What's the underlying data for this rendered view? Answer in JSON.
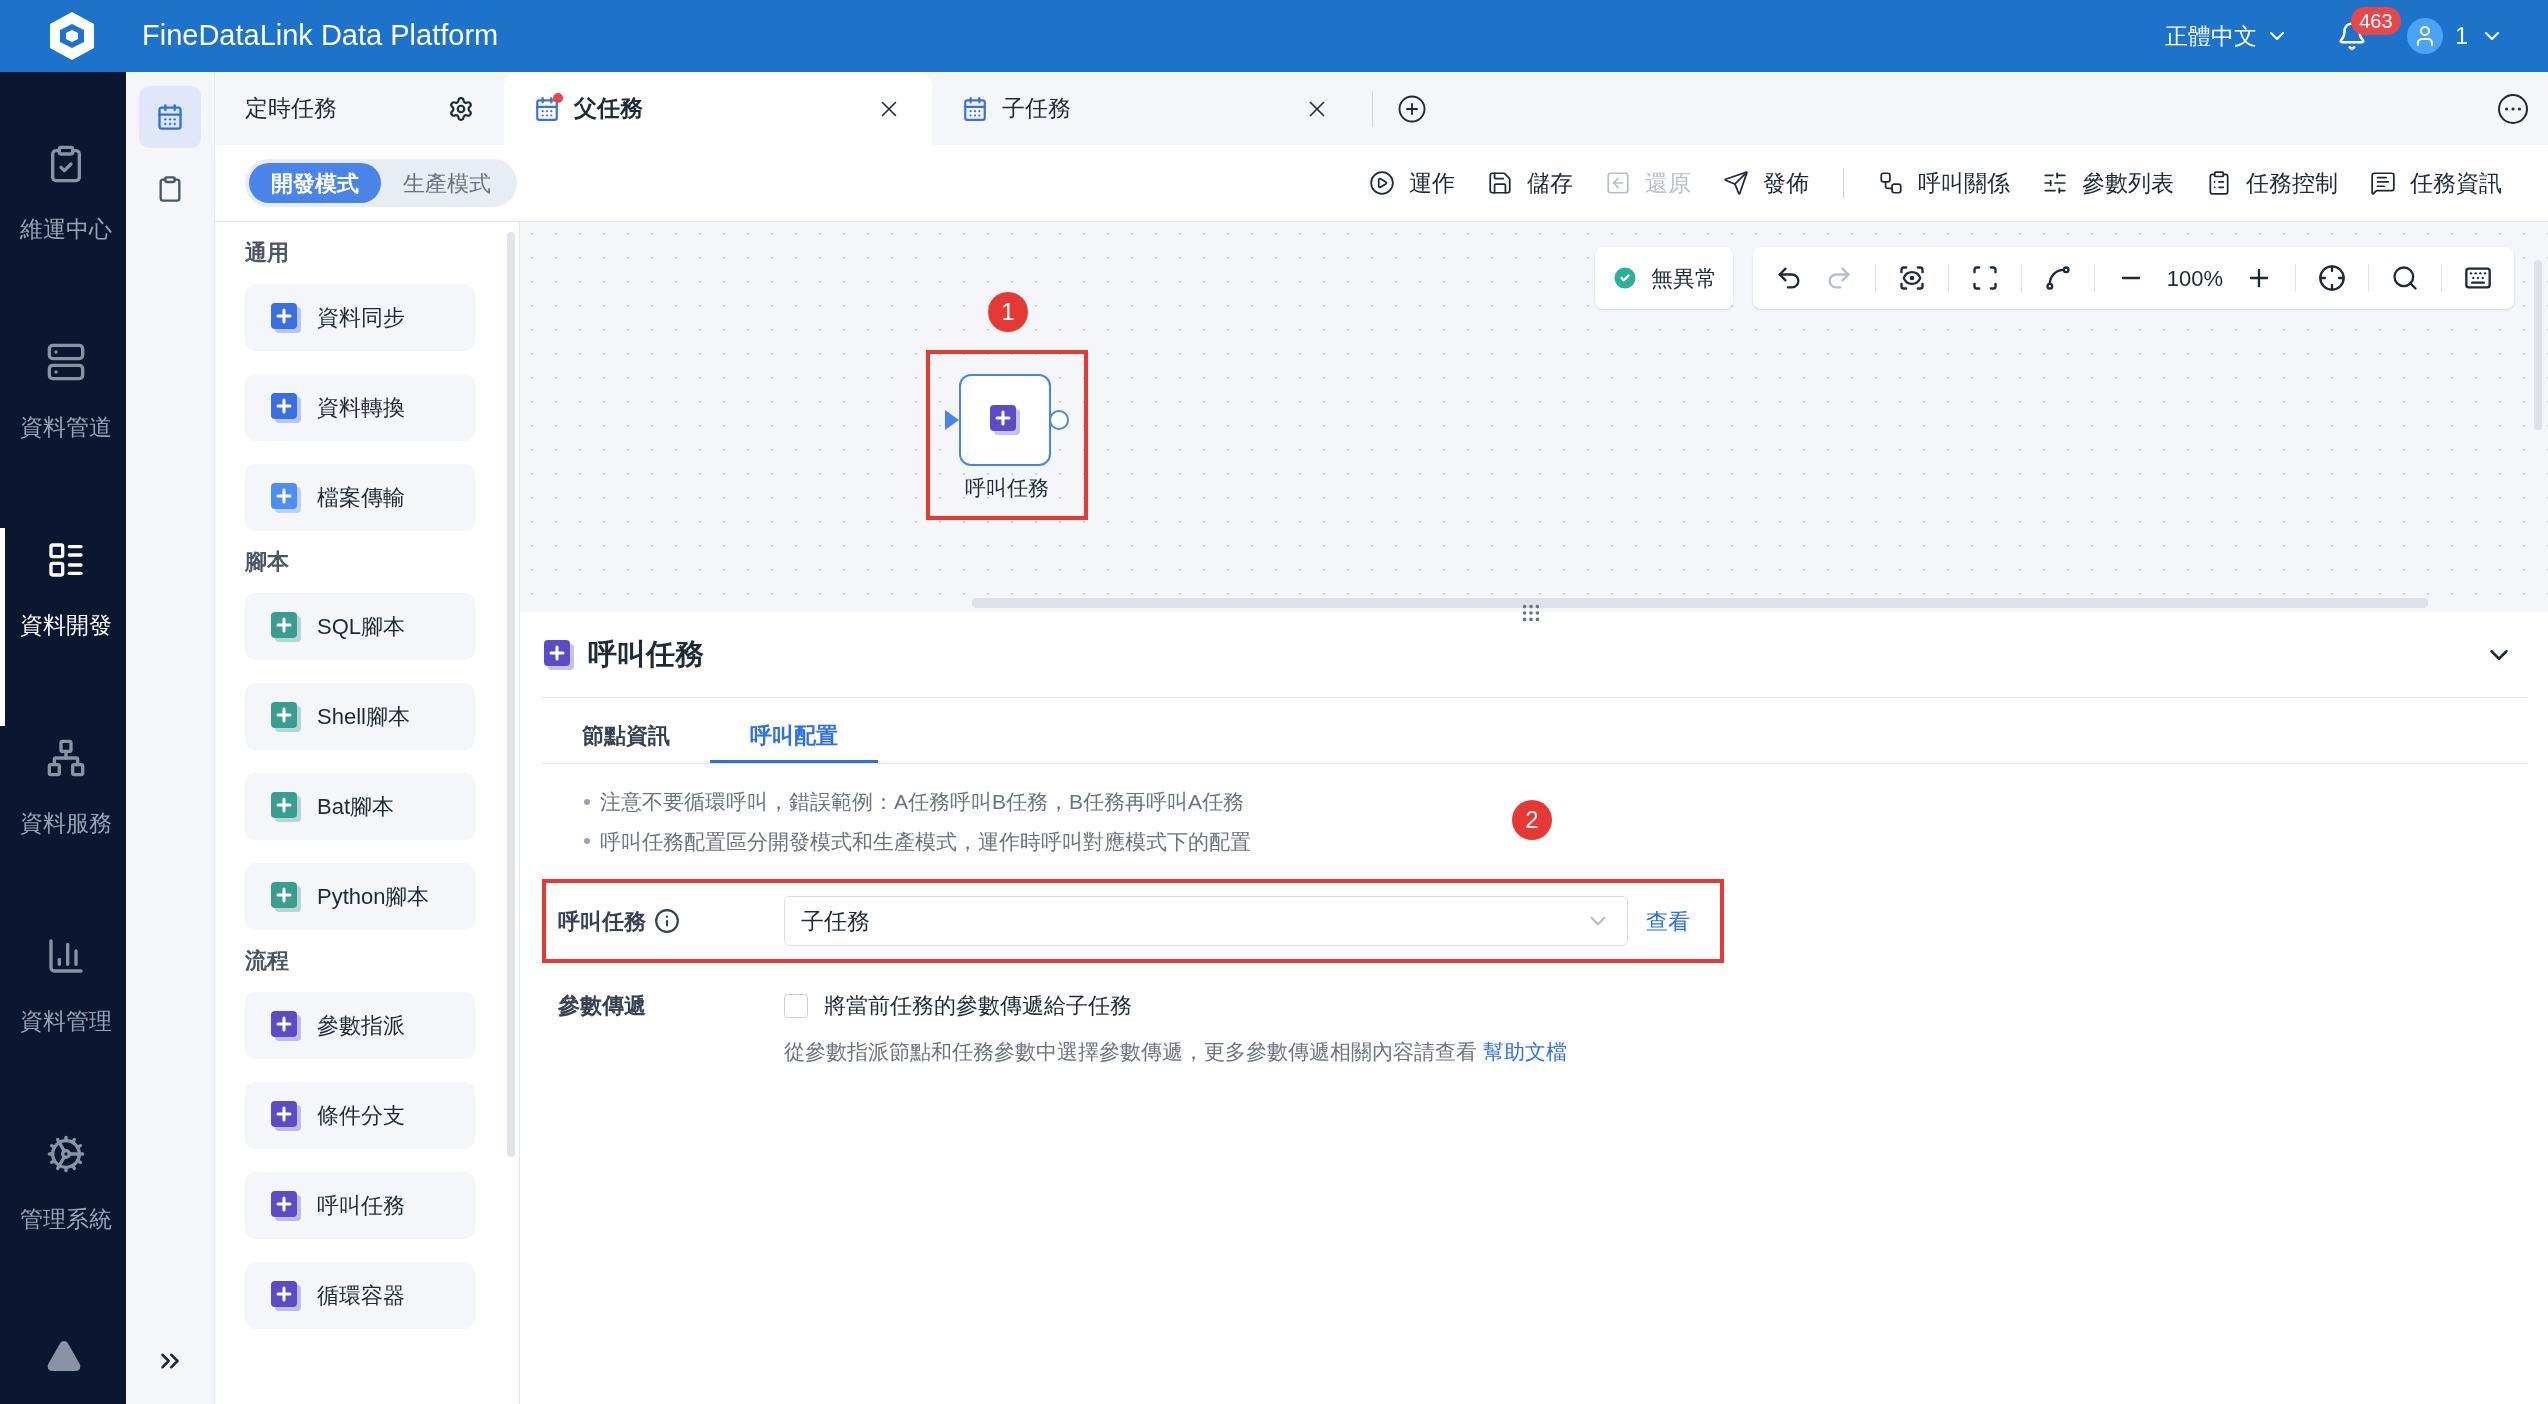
{
  "header": {
    "title": "FineDataLink Data Platform",
    "language": "正體中文",
    "notifications": "463",
    "user": "1"
  },
  "nav": {
    "items": [
      {
        "kind": "ops",
        "label": "維運中心",
        "selected": false
      },
      {
        "kind": "pipeline",
        "label": "資料管道",
        "selected": false
      },
      {
        "kind": "dev",
        "label": "資料開發",
        "selected": true
      },
      {
        "kind": "service",
        "label": "資料服務",
        "selected": false
      },
      {
        "kind": "manage",
        "label": "資料管理",
        "selected": false
      },
      {
        "kind": "system",
        "label": "管理系統",
        "selected": false
      }
    ]
  },
  "subnav": {
    "items": [
      {
        "kind": "task",
        "selected": true
      },
      {
        "kind": "clipboard",
        "selected": false
      }
    ]
  },
  "tabs": [
    {
      "kind": "scheduled",
      "label": "定時任務",
      "selected": false
    },
    {
      "kind": "task",
      "label": "父任務",
      "selected": true,
      "modified": true
    },
    {
      "kind": "task",
      "label": "子任務",
      "selected": false,
      "modified": false
    }
  ],
  "modes": [
    {
      "label": "開發模式",
      "selected": true
    },
    {
      "label": "生產模式",
      "selected": false
    }
  ],
  "toolbar": {
    "primary": [
      {
        "kind": "run",
        "label": "運作",
        "disabled": false
      },
      {
        "kind": "save",
        "label": "儲存",
        "disabled": false
      },
      {
        "kind": "restore",
        "label": "還原",
        "disabled": true
      },
      {
        "kind": "publish",
        "label": "發佈",
        "disabled": false
      }
    ],
    "secondary": [
      {
        "kind": "relation",
        "label": "呼叫關係",
        "disabled": false
      },
      {
        "kind": "params",
        "label": "參數列表",
        "disabled": false
      },
      {
        "kind": "control",
        "label": "任務控制",
        "disabled": false
      },
      {
        "kind": "info",
        "label": "任務資訊",
        "disabled": false
      }
    ]
  },
  "palette": [
    {
      "title": "通用",
      "items": [
        {
          "kind": "sync",
          "label": "資料同步"
        },
        {
          "kind": "transform",
          "label": "資料轉換"
        },
        {
          "kind": "file",
          "label": "檔案傳輸"
        }
      ]
    },
    {
      "title": "腳本",
      "items": [
        {
          "kind": "sql",
          "label": "SQL腳本"
        },
        {
          "kind": "shell",
          "label": "Shell腳本"
        },
        {
          "kind": "bat",
          "label": "Bat腳本"
        },
        {
          "kind": "python",
          "label": "Python腳本"
        }
      ]
    },
    {
      "title": "流程",
      "items": [
        {
          "kind": "assign",
          "label": "參數指派"
        },
        {
          "kind": "branch",
          "label": "條件分支"
        },
        {
          "kind": "call",
          "label": "呼叫任務"
        },
        {
          "kind": "loop",
          "label": "循環容器"
        }
      ]
    }
  ],
  "canvas": {
    "status": "無異常",
    "zoom": "100%",
    "tools": [
      {
        "kind": "undo",
        "disabled": false
      },
      {
        "kind": "redo",
        "disabled": true
      }
    ],
    "node": {
      "label": "呼叫任務",
      "marker": "1"
    }
  },
  "panel": {
    "title": "呼叫任務",
    "tabs": [
      {
        "label": "節點資訊",
        "selected": false
      },
      {
        "label": "呼叫配置",
        "selected": true
      }
    ],
    "notes": [
      "注意不要循環呼叫，錯誤範例：A任務呼叫B任務，B任務再呼叫A任務",
      "呼叫任務配置區分開發模式和生產模式，運作時呼叫對應模式下的配置"
    ],
    "marker": "2",
    "call_task": {
      "label": "呼叫任務",
      "value": "子任務",
      "link": "查看"
    },
    "param_pass": {
      "label": "參數傳遞",
      "checked": false,
      "option": "將當前任務的參數傳遞給子任務",
      "help": "從參數指派節點和任務參數中選擇參數傳遞，更多參數傳遞相關內容請查看",
      "help_link": "幫助文檔"
    }
  }
}
